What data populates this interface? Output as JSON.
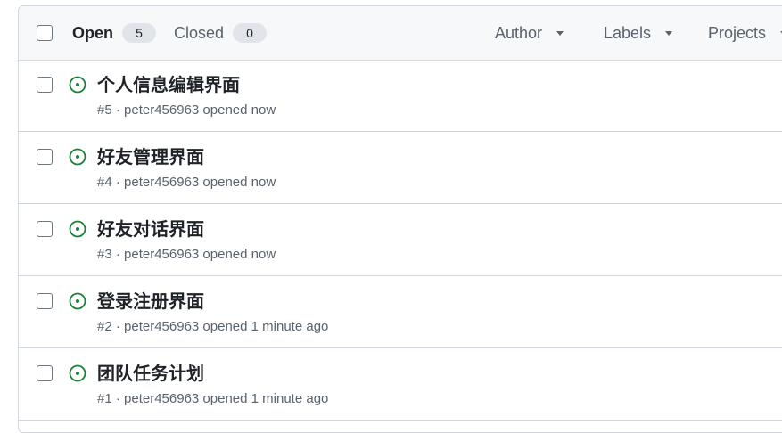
{
  "tabs": {
    "open_label": "Open",
    "open_count": "5",
    "closed_label": "Closed",
    "closed_count": "0"
  },
  "filters": {
    "author": "Author",
    "labels": "Labels",
    "projects": "Projects"
  },
  "issues": [
    {
      "title": "个人信息编辑界面",
      "meta": "#5 · peter456963 opened now"
    },
    {
      "title": "好友管理界面",
      "meta": "#4 · peter456963 opened now"
    },
    {
      "title": "好友对话界面",
      "meta": "#3 · peter456963 opened now"
    },
    {
      "title": "登录注册界面",
      "meta": "#2 · peter456963 opened 1 minute ago"
    },
    {
      "title": "团队任务计划",
      "meta": "#1 · peter456963 opened 1 minute ago"
    }
  ],
  "colors": {
    "open_icon": "#1a7f37",
    "border": "#d0d7de",
    "header_bg": "#f6f8fa"
  },
  "icons": {
    "issue_state": "issue-opened-icon",
    "dropdown": "triangle-down-icon"
  }
}
